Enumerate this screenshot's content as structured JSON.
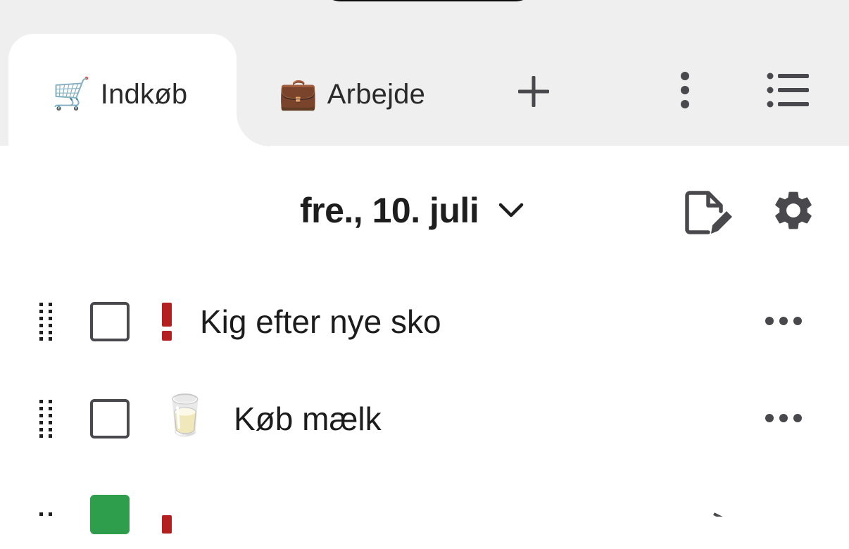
{
  "tabs": [
    {
      "emoji": "🛒",
      "label": "Indkøb",
      "active": true
    },
    {
      "emoji": "💼",
      "label": "Arbejde",
      "active": false
    }
  ],
  "toolbar": {
    "add_icon": "plus-icon",
    "more_icon": "more-vert-icon",
    "list_icon": "list-icon"
  },
  "header": {
    "date": "fre., 10. juli",
    "edit_icon": "edit-note-icon",
    "settings_icon": "gear-icon"
  },
  "items": [
    {
      "text": "Kig efter nye sko",
      "priority": true,
      "emoji": "",
      "checked": false
    },
    {
      "text": "Køb mælk",
      "priority": false,
      "emoji": "🥛",
      "checked": false
    },
    {
      "text": "",
      "priority": true,
      "emoji": "",
      "checked": true
    }
  ],
  "colors": {
    "tab_strip_bg": "#efefef",
    "priority_red": "#b3201f",
    "checkbox_border": "#48484d",
    "checked_green": "#2e9e4c",
    "icon_gray": "#48484d"
  }
}
